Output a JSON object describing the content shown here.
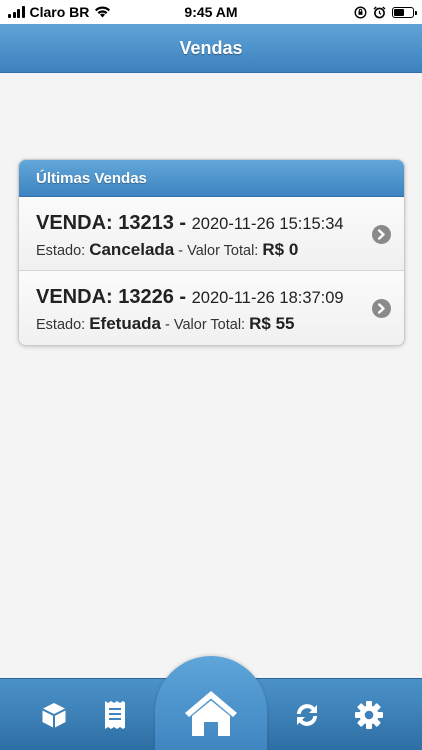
{
  "status_bar": {
    "carrier": "Claro BR",
    "time": "9:45 AM"
  },
  "header": {
    "title": "Vendas"
  },
  "sales_panel": {
    "title": "Últimas Vendas",
    "sales": [
      {
        "label": "VENDA: 13213 -",
        "datetime": "2020-11-26 15:15:34",
        "state_label": "Estado:",
        "state": "Cancelada",
        "total_label": "- Valor Total:",
        "total": "R$ 0"
      },
      {
        "label": "VENDA: 13226 -",
        "datetime": "2020-11-26 18:37:09",
        "state_label": "Estado:",
        "state": "Efetuada",
        "total_label": "- Valor Total:",
        "total": "R$ 55"
      }
    ]
  },
  "bottom_nav": {
    "items": [
      {
        "icon": "box-icon"
      },
      {
        "icon": "receipt-icon"
      },
      {
        "icon": "home-icon"
      },
      {
        "icon": "sync-icon"
      },
      {
        "icon": "gear-icon"
      }
    ]
  },
  "colors": {
    "accent": "#3d82bf",
    "header_top": "#5fa3d6",
    "background": "#f4f4f4"
  }
}
